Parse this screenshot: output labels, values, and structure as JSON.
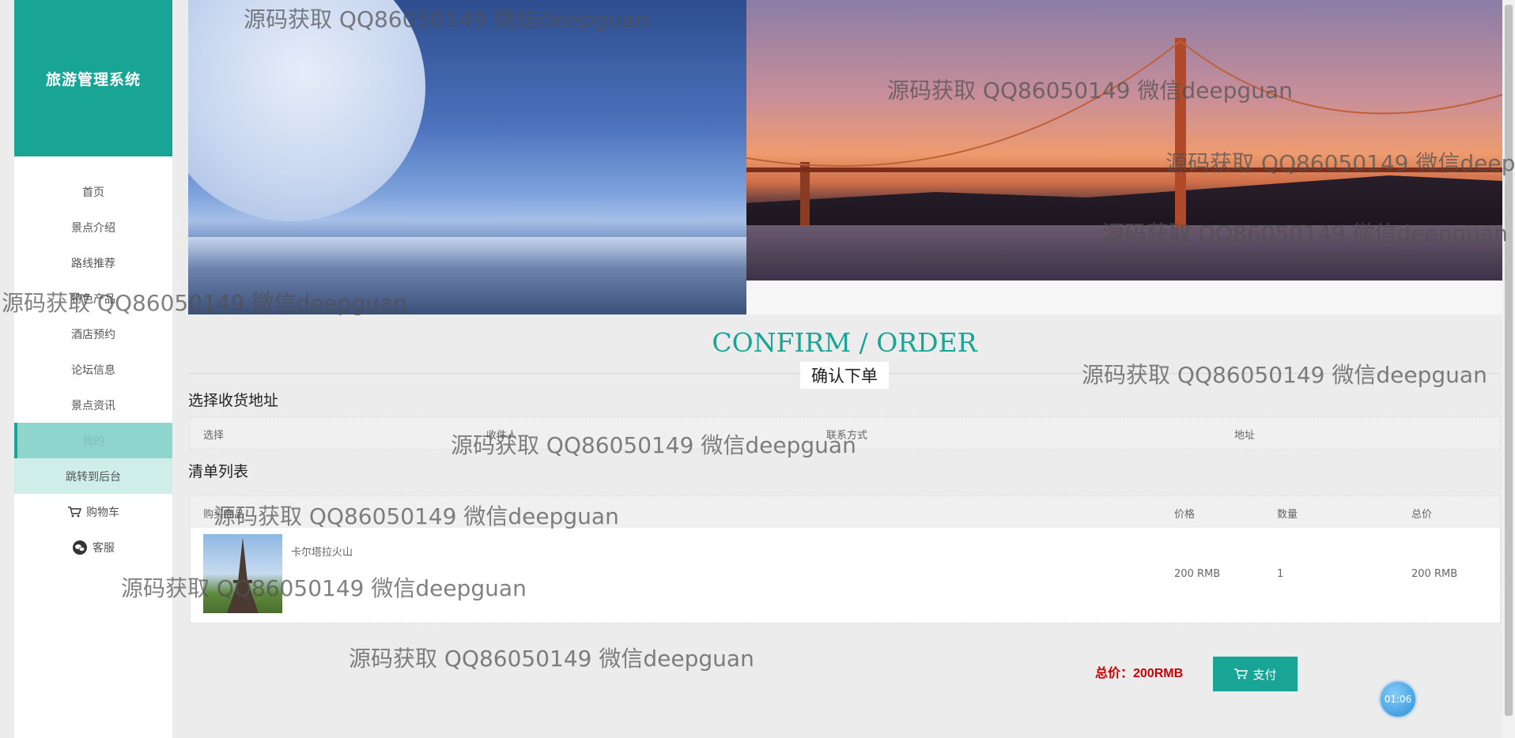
{
  "sidebar": {
    "brand": "旅游管理系统",
    "items": [
      "首页",
      "景点介绍",
      "路线推荐",
      "特色产品",
      "酒店预约",
      "论坛信息",
      "景点资讯",
      "我的",
      "跳转到后台",
      "购物车",
      "客服"
    ]
  },
  "order": {
    "title_en": "CONFIRM / ORDER",
    "title_cn": "确认下单",
    "address_heading": "选择收货地址",
    "address_columns": [
      "选择",
      "收件人",
      "联系方式",
      "地址"
    ],
    "list_heading": "清单列表",
    "list_columns": [
      "购买商品",
      "价格",
      "数量",
      "总价"
    ],
    "items": [
      {
        "name": "卡尔塔拉火山",
        "price": "200 RMB",
        "qty": "1",
        "total": "200 RMB"
      }
    ],
    "total_label": "总价：200RMB",
    "pay_label": "支付",
    "timer": "01:06"
  },
  "watermark": "源码获取 QQ86050149 微信deepguan",
  "colors": {
    "accent": "#18a596",
    "total": "#c80000"
  }
}
